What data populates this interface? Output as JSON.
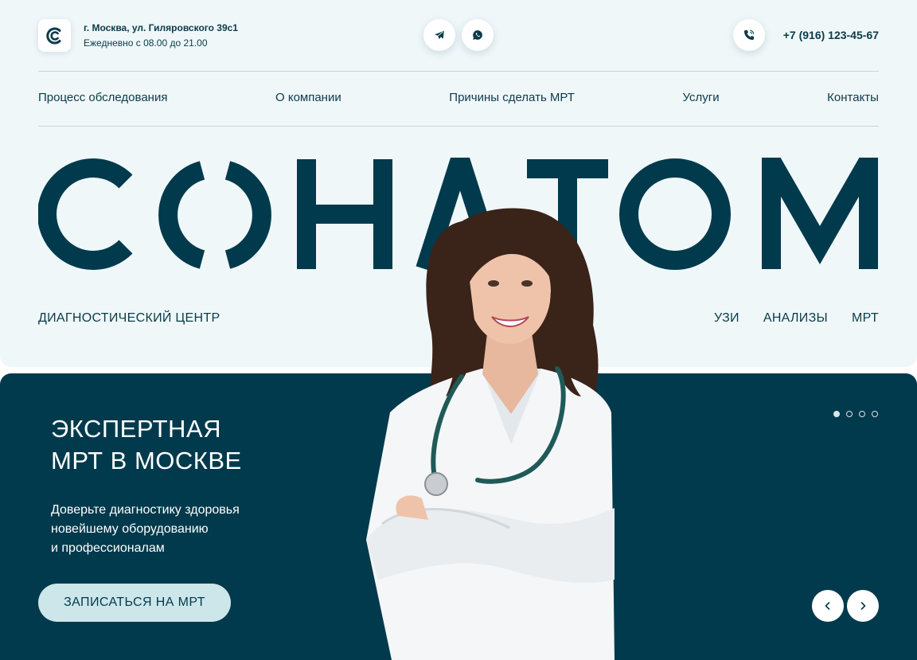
{
  "header": {
    "address_line1": "г. Москва, ул. Гиляровского 39с1",
    "address_line2": "Ежедневно с 08.00 до 21.00",
    "social": [
      "telegram-icon",
      "whatsapp-icon"
    ],
    "phone": "+7 (916) 123-45-67"
  },
  "nav": {
    "items": [
      "Процесс обследования",
      "О компании",
      "Причины сделать МРТ",
      "Услуги",
      "Контакты"
    ]
  },
  "brand": {
    "name": "СОНАТОМ",
    "subtitle": "ДИАГНОСТИЧЕСКИЙ ЦЕНТР",
    "services": [
      "УЗИ",
      "АНАЛИЗЫ",
      "МРТ"
    ]
  },
  "hero": {
    "title_line1": "ЭКСПЕРТНАЯ",
    "title_line2": "МРТ В МОСКВЕ",
    "text_line1": "Доверьте диагностику здоровья",
    "text_line2": "новейшему оборудованию",
    "text_line3": "и профессионалам",
    "cta_label": "ЗАПИСАТЬСЯ НА МРТ",
    "slides_total": 4,
    "active_slide": 1
  },
  "colors": {
    "primary": "#003a4c",
    "light_bg": "#eff7f9",
    "cta_bg": "#cde6ea",
    "text": "#0b3b4a"
  }
}
